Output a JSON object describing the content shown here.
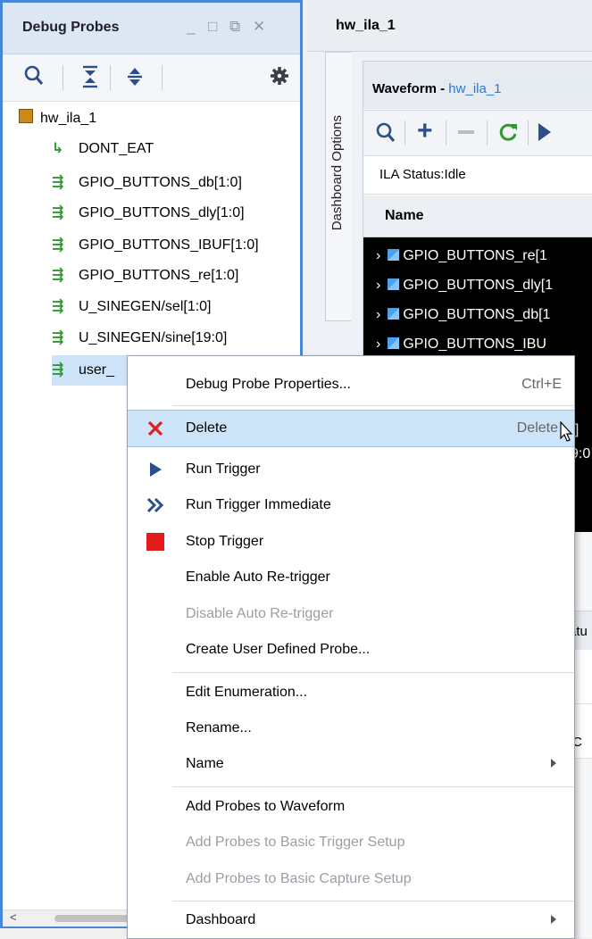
{
  "left_panel": {
    "title": "Debug Probes",
    "window_controls": {
      "minimize": "_",
      "maximize": "□",
      "restore": "⧉",
      "close": "✕"
    },
    "toolbar_icons": [
      "search-icon",
      "collapse-all-icon",
      "expand-icon",
      "gear-icon"
    ],
    "tree": {
      "root": "hw_ila_1",
      "items": [
        "DONT_EAT",
        "GPIO_BUTTONS_db[1:0]",
        "GPIO_BUTTONS_dly[1:0]",
        "GPIO_BUTTONS_IBUF[1:0]",
        "GPIO_BUTTONS_re[1:0]",
        "U_SINEGEN/sel[1:0]",
        "U_SINEGEN/sine[19:0]",
        "user_"
      ]
    },
    "scroll_left_arrow": "<"
  },
  "right_panel": {
    "title": "hw_ila_1",
    "side_tab": "Dashboard Options",
    "waveform": {
      "title_prefix": "Waveform - ",
      "title_link": "hw_ila_1",
      "ila_status": "ILA Status:Idle",
      "name_header": "Name",
      "rows": [
        "GPIO_BUTTONS_re[1",
        "GPIO_BUTTONS_dly[1",
        "GPIO_BUTTONS_db[1",
        "GPIO_BUTTONS_IBU",
        "0]",
        "9:0"
      ],
      "partial_labels": [
        "atu",
        "IC"
      ]
    }
  },
  "context_menu": {
    "items": [
      {
        "label": "Debug Probe Properties...",
        "shortcut": "Ctrl+E",
        "icon": "",
        "enabled": true
      },
      {
        "label": "Delete",
        "shortcut": "Delete",
        "icon": "delete-x-icon",
        "enabled": true,
        "highlighted": true
      },
      {
        "label": "Run Trigger",
        "shortcut": "",
        "icon": "run-trigger-icon",
        "enabled": true
      },
      {
        "label": "Run Trigger Immediate",
        "shortcut": "",
        "icon": "run-immediate-icon",
        "enabled": true
      },
      {
        "label": "Stop Trigger",
        "shortcut": "",
        "icon": "stop-trigger-icon",
        "enabled": true
      },
      {
        "label": "Enable Auto Re-trigger",
        "shortcut": "",
        "icon": "",
        "enabled": true
      },
      {
        "label": "Disable Auto Re-trigger",
        "shortcut": "",
        "icon": "",
        "enabled": false
      },
      {
        "label": "Create User Defined Probe...",
        "shortcut": "",
        "icon": "",
        "enabled": true
      },
      {
        "label": "Edit Enumeration...",
        "shortcut": "",
        "icon": "",
        "enabled": true
      },
      {
        "label": "Rename...",
        "shortcut": "",
        "icon": "",
        "enabled": true
      },
      {
        "label": "Name",
        "shortcut": "",
        "icon": "",
        "enabled": true,
        "submenu": true
      },
      {
        "label": "Add Probes to Waveform",
        "shortcut": "",
        "icon": "",
        "enabled": true
      },
      {
        "label": "Add Probes to Basic Trigger Setup",
        "shortcut": "",
        "icon": "",
        "enabled": false
      },
      {
        "label": "Add Probes to Basic Capture Setup",
        "shortcut": "",
        "icon": "",
        "enabled": false
      },
      {
        "label": "Dashboard",
        "shortcut": "",
        "icon": "",
        "enabled": true,
        "submenu": true
      }
    ]
  },
  "colors": {
    "panel_border": "#4a86d6",
    "menu_highlight": "#cde3f7",
    "selection": "#cde3f7",
    "delete_icon": "#e02020",
    "run_icon": "#2a4f8f",
    "stop_icon": "#e31b1b",
    "link": "#2a7ad5"
  }
}
